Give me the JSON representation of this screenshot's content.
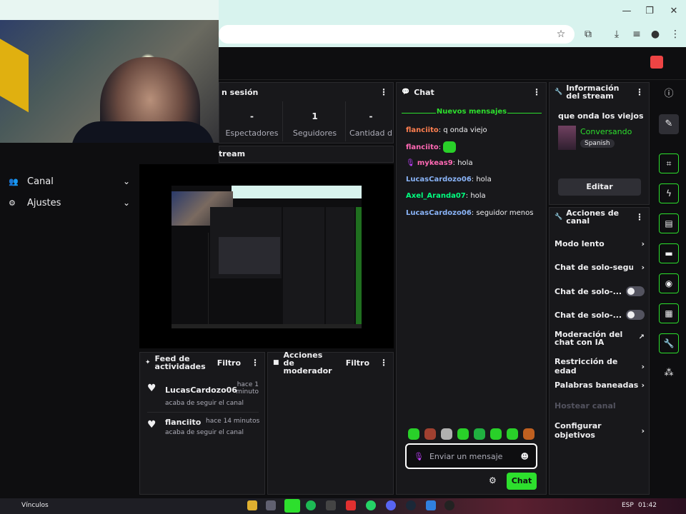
{
  "colors": {
    "accent": "#2ddf2d",
    "bg": "#0e0e10",
    "panel": "#18181b"
  },
  "sidebar": {
    "items": [
      {
        "label": "Canal",
        "icon": "people-icon"
      },
      {
        "label": "Ajustes",
        "icon": "gear-icon"
      }
    ]
  },
  "session": {
    "title": "n sesión",
    "stats": [
      {
        "value": "-",
        "label": "Espectadores"
      },
      {
        "value": "1",
        "label": "Seguidores"
      },
      {
        "value": "-",
        "label": "Cantidad d"
      }
    ]
  },
  "stream_preview": {
    "title": "tream"
  },
  "feed": {
    "title": "Feed de actividades",
    "filter": "Filtro",
    "items": [
      {
        "user": "LucasCardozo06",
        "time": "hace 1 minuto",
        "action": "acaba de seguir el canal"
      },
      {
        "user": "flanciito",
        "time": "hace 14 minutos",
        "action": "acaba de seguir el canal"
      }
    ]
  },
  "mod_actions": {
    "title": "Acciones de moderador",
    "filter": "Filtro"
  },
  "chat": {
    "title": "Chat",
    "new_messages": "Nuevos mensajes",
    "messages": [
      {
        "user": "flanciito",
        "text": ": q onda viejo",
        "color": "orange"
      },
      {
        "user": "flanciito",
        "text": ":",
        "color": "pink",
        "emote": true
      },
      {
        "user": "mykeas9",
        "text": ": hola",
        "color": "pink"
      },
      {
        "user": "LucasCardozo06",
        "text": ": hola",
        "color": "blue"
      },
      {
        "user": "Axel_Aranda07",
        "text": ": hola",
        "color": "green"
      },
      {
        "user": "LucasCardozo06",
        "text": ": seguidor menos",
        "color": "blue"
      }
    ],
    "input_placeholder": "Enviar un mensaje",
    "send_label": "Chat"
  },
  "stream_info": {
    "title": "Información del stream",
    "stream_title": "que onda los viejos",
    "category": "Conversando",
    "language": "Spanish",
    "edit_label": "Editar"
  },
  "channel_actions": {
    "title": "Acciones de canal",
    "items": [
      {
        "label": "Modo lento",
        "kind": "chevron"
      },
      {
        "label": "Chat de solo-seguid",
        "kind": "chevron"
      },
      {
        "label": "Chat de solo-...",
        "kind": "toggle"
      },
      {
        "label": "Chat de solo-...",
        "kind": "toggle"
      },
      {
        "label": "Moderación del chat con IA",
        "kind": "external"
      },
      {
        "label": "Restricción de edad",
        "kind": "chevron"
      },
      {
        "label": "Palabras baneadas",
        "kind": "chevron"
      },
      {
        "label": "Hostear canal",
        "kind": "disabled"
      },
      {
        "label": "Configurar objetivos",
        "kind": "chevron"
      }
    ]
  },
  "taskbar": {
    "links_label": "Vínculos",
    "lang": "ESP",
    "time": "01:42"
  }
}
